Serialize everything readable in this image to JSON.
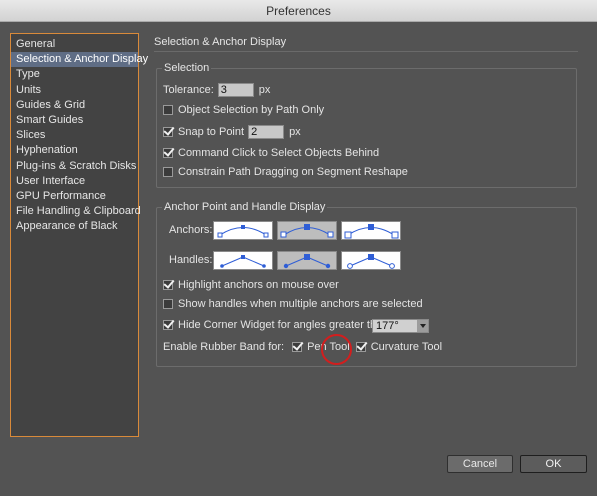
{
  "window": {
    "title": "Preferences"
  },
  "sidebar": {
    "items": [
      {
        "label": "General"
      },
      {
        "label": "Selection & Anchor Display",
        "selected": true
      },
      {
        "label": "Type"
      },
      {
        "label": "Units"
      },
      {
        "label": "Guides & Grid"
      },
      {
        "label": "Smart Guides"
      },
      {
        "label": "Slices"
      },
      {
        "label": "Hyphenation"
      },
      {
        "label": "Plug-ins & Scratch Disks"
      },
      {
        "label": "User Interface"
      },
      {
        "label": "GPU Performance"
      },
      {
        "label": "File Handling & Clipboard"
      },
      {
        "label": "Appearance of Black"
      }
    ]
  },
  "main": {
    "section_title": "Selection & Anchor Display",
    "selection": {
      "title": "Selection",
      "tolerance_label": "Tolerance:",
      "tolerance_value": "3",
      "tolerance_unit": "px",
      "object_selection_label": "Object Selection by Path Only",
      "object_selection_checked": false,
      "snap_label": "Snap to Point",
      "snap_checked": true,
      "snap_value": "2",
      "snap_unit": "px",
      "command_click_label": "Command Click to Select Objects Behind",
      "command_click_checked": true,
      "constrain_label": "Constrain Path Dragging on Segment Reshape",
      "constrain_checked": false
    },
    "anchor": {
      "title": "Anchor Point and Handle Display",
      "anchors_label": "Anchors:",
      "handles_label": "Handles:",
      "highlight_label": "Highlight anchors on mouse over",
      "highlight_checked": true,
      "show_handles_label": "Show handles when multiple anchors are selected",
      "show_handles_checked": false,
      "hide_corner_label": "Hide Corner Widget for angles greater than:",
      "hide_corner_checked": true,
      "hide_corner_value": "177°",
      "rubber_band_label": "Enable Rubber Band for:",
      "pen_tool_label": "Pen Tool",
      "pen_tool_checked": true,
      "curvature_tool_label": "Curvature Tool",
      "curvature_tool_checked": true
    }
  },
  "footer": {
    "cancel_label": "Cancel",
    "ok_label": "OK"
  },
  "colors": {
    "background": "#535353",
    "sidebar_border": "#d98a3a",
    "selected_item": "#5f6d85",
    "annotation_circle": "#d21e1e",
    "anchor_blue": "#2f5ed6"
  }
}
